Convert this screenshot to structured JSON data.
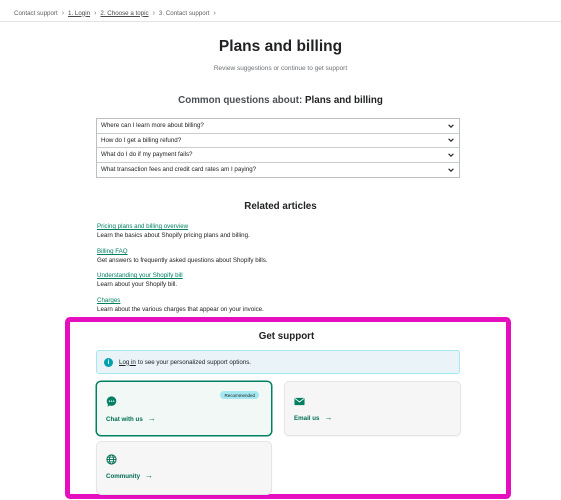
{
  "breadcrumb": {
    "root": "Contact support",
    "step1": "1. Login",
    "step2": "2. Choose a topic",
    "step3": "3. Contact support"
  },
  "page": {
    "title": "Plans and billing",
    "subtitle": "Review suggestions or continue to get support"
  },
  "common_questions": {
    "prefix": "Common questions about:",
    "topic": "Plans and billing",
    "items": [
      "Where can I learn more about billing?",
      "How do I get a billing refund?",
      "What do I do if my payment fails?",
      "What transaction fees and credit card rates am I paying?"
    ]
  },
  "related_articles": {
    "heading": "Related articles",
    "items": [
      {
        "title": "Pricing plans and billing overview",
        "desc": "Learn the basics about Shopify pricing plans and billing."
      },
      {
        "title": "Billing FAQ",
        "desc": "Get answers to frequently asked questions about Shopify bills."
      },
      {
        "title": "Understanding your Shopify bill",
        "desc": "Learn about your Shopify bill."
      },
      {
        "title": "Charges",
        "desc": "Learn about the various charges that appear on your invoice."
      }
    ]
  },
  "get_support": {
    "heading": "Get support",
    "banner": {
      "link": "Log in",
      "text": "to see your personalized support options."
    },
    "options": {
      "chat": {
        "label": "Chat with us",
        "badge": "Recommended"
      },
      "email": {
        "label": "Email us"
      },
      "community": {
        "label": "Community"
      }
    },
    "arrow": "→"
  },
  "colors": {
    "accent": "#008060",
    "link": "#007f5f",
    "highlight_border": "#e60fbf",
    "banner_bg": "#eaf4f8"
  },
  "icons": [
    "chevron-right-icon",
    "chevron-down-icon",
    "info-icon",
    "chat-bubble-icon",
    "envelope-icon",
    "globe-icon",
    "arrow-right-icon"
  ]
}
